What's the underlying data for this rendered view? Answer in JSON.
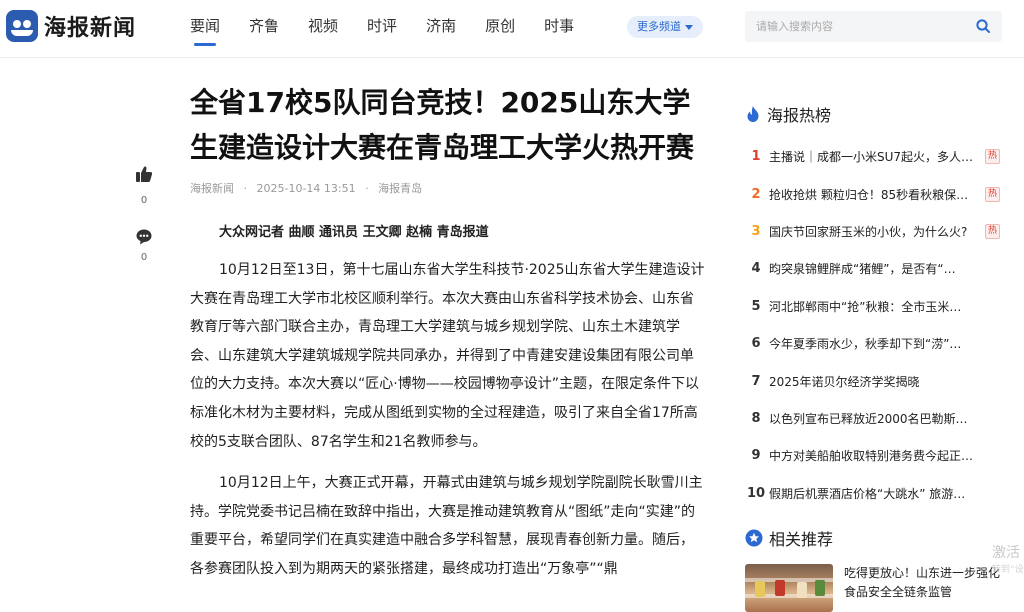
{
  "header": {
    "logo_text": "海报新闻",
    "nav": [
      "要闻",
      "齐鲁",
      "视频",
      "时评",
      "济南",
      "原创",
      "时事"
    ],
    "more_label": "更多频道",
    "search_placeholder": "请输入搜索内容"
  },
  "actions": {
    "like_count": "0",
    "comment_count": "0"
  },
  "article": {
    "title": "全省17校5队同台竞技！2025山东大学生建造设计大赛在青岛理工大学火热开赛",
    "meta_source": "海报新闻",
    "meta_time": "2025-10-14 13:51",
    "meta_channel": "海报青岛",
    "byline": "大众网记者 曲顺 通讯员 王文卿 赵楠 青岛报道",
    "para1": "10月12日至13日，第十七届山东省大学生科技节·2025山东省大学生建造设计大赛在青岛理工大学市北校区顺利举行。本次大赛由山东省科学技术协会、山东省教育厅等六部门联合主办，青岛理工大学建筑与城乡规划学院、山东土木建筑学会、山东建筑大学建筑城规学院共同承办，并得到了中青建安建设集团有限公司单位的大力支持。本次大赛以“匠心·博物——校园博物亭设计”主题，在限定条件下以标准化木材为主要材料，完成从图纸到实物的全过程建造，吸引了来自全省17所高校的5支联合团队、87名学生和21名教师参与。",
    "para2": "10月12日上午，大赛正式开幕，开幕式由建筑与城乡规划学院副院长耿雪川主持。学院党委书记吕楠在致辞中指出，大赛是推动建筑教育从“图纸”走向“实建”的重要平台，希望同学们在真实建造中融合多学科智慧，展现青春创新力量。随后，各参赛团队投入到为期两天的紧张搭建，最终成功打造出“万象亭”“鼎"
  },
  "sidebar": {
    "hot_title": "海报热榜",
    "hot_badge": "热",
    "hot": [
      {
        "rank": "1",
        "text": "主播说｜成都一小米SU7起火，多人…",
        "badge": true
      },
      {
        "rank": "2",
        "text": "抢收抢烘 颗粒归仓！85秒看秋粮保…",
        "badge": true
      },
      {
        "rank": "3",
        "text": "国庆节回家掰玉米的小伙，为什么火?",
        "badge": true
      },
      {
        "rank": "4",
        "text": "昀突泉锦鲤胖成“猪鲤”，是否有“…",
        "badge": false
      },
      {
        "rank": "5",
        "text": "河北邯郸雨中“抢”秋粮：全市玉米…",
        "badge": false
      },
      {
        "rank": "6",
        "text": "今年夏季雨水少，秋季却下到“涝”…",
        "badge": false
      },
      {
        "rank": "7",
        "text": "2025年诺贝尔经济学奖揭晓",
        "badge": false
      },
      {
        "rank": "8",
        "text": "以色列宣布已释放近2000名巴勒斯坦…",
        "badge": false
      },
      {
        "rank": "9",
        "text": "中方对美船舶收取特别港务费今起正…",
        "badge": false
      },
      {
        "rank": "10",
        "text": "假期后机票酒店价格“大跳水” 旅游…",
        "badge": false
      }
    ],
    "rec_title": "相关推荐",
    "rec_item": "吃得更放心！山东进一步强化食品安全全链条监管"
  },
  "watermark": {
    "line1": "激活",
    "line2": "转到“设"
  }
}
